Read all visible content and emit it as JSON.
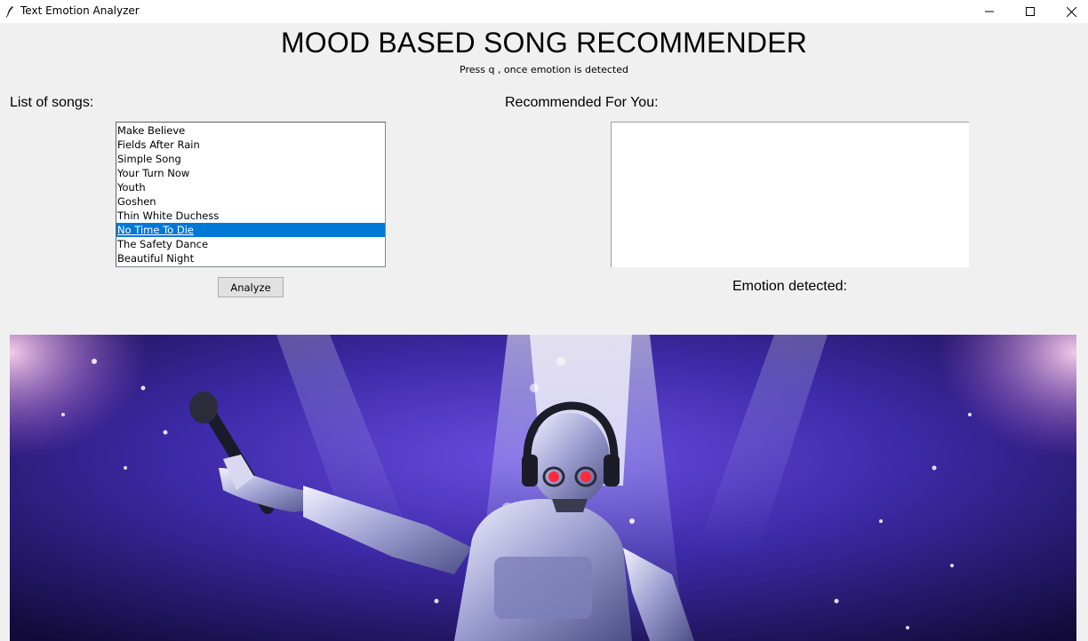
{
  "window": {
    "title": "Text Emotion Analyzer",
    "controls": [
      "minimize",
      "maximize",
      "close"
    ]
  },
  "header": {
    "title": "MOOD BASED SONG RECOMMENDER",
    "subtitle": "Press q , once emotion is detected"
  },
  "songs": {
    "label": "List of songs:",
    "items": [
      "Make Believe",
      "Fields After Rain",
      "Simple Song",
      "Your Turn Now",
      "Youth",
      "Goshen",
      "Thin White Duchess",
      "No Time To Die",
      "The Safety Dance",
      "Beautiful Night"
    ],
    "selected_index": 7,
    "selected_value": "No Time To Die"
  },
  "recommended": {
    "label": "Recommended For You:",
    "items": []
  },
  "emotion": {
    "label": "Emotion detected:",
    "value": ""
  },
  "actions": {
    "analyze_label": "Analyze"
  },
  "banner": {
    "image_subject": "robot-singer-stage-illustration"
  },
  "colors": {
    "selection": "#0078d7",
    "window_bg": "#f0f0f0",
    "stage_purple": "#4a2fb0"
  }
}
